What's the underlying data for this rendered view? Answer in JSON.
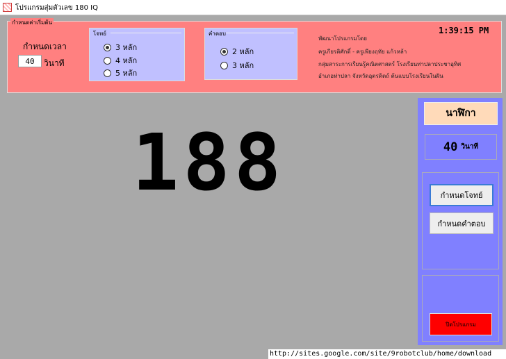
{
  "window": {
    "title": "โปรแกรมสุ่มตัวเลข 180 IQ"
  },
  "settings": {
    "legend": "กำหนดค่าเริ่มต้น",
    "time_label": "กำหนดเวลา",
    "time_value": "40",
    "seconds_label": "วินาที"
  },
  "question_group": {
    "legend": "โจทย์",
    "options": [
      "3 หลัก",
      "4 หลัก",
      "5 หลัก"
    ],
    "selected": "3 หลัก"
  },
  "answer_group": {
    "legend": "คำตอบ",
    "options": [
      "2 หลัก",
      "3 หลัก"
    ],
    "selected": "2 หลัก"
  },
  "credits": {
    "lines": [
      "พัฒนาโปรแกรมโดย",
      "ครูเกียรติศักดิ์ - ครูเพียงฤทัย แก้วหล้า",
      "กลุ่มสาระการเรียนรู้คณิตศาสตร์ โรงเรียนท่าปลาประชาอุทิศ",
      "อำเภอท่าปลา จังหวัดอุตรดิตถ์ ต้นแบบโรงเรียนในฝัน"
    ]
  },
  "clock": "1:39:15 PM",
  "display": {
    "number": "188"
  },
  "side": {
    "timer_title": "นาฬิกา",
    "timer_value": "40",
    "timer_unit": "วินาที",
    "set_question": "กำหนดโจทย์",
    "set_answer": "กำหนดคำตอบ",
    "close": "ปิดโปรแกรม"
  },
  "footer": {
    "url": "http://sites.google.com/site/9robotclub/home/download"
  }
}
